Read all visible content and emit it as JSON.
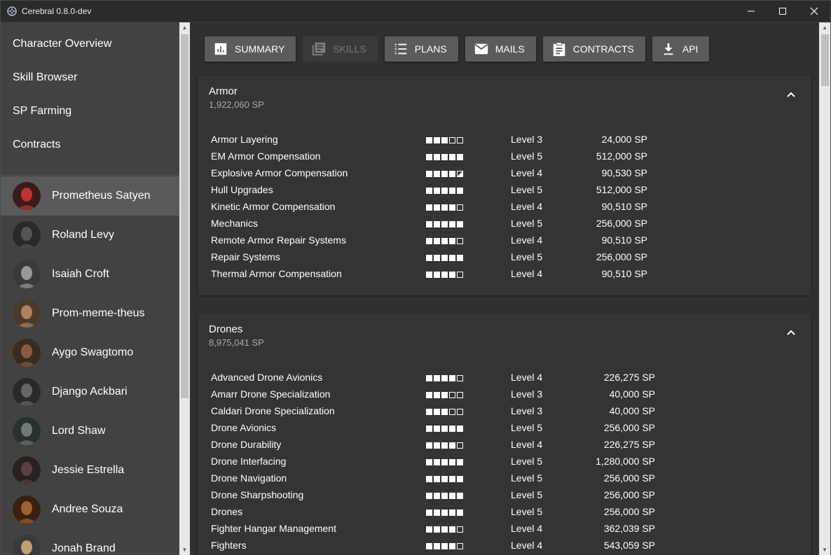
{
  "window": {
    "title": "Cerebral 0.8.0-dev"
  },
  "nav": [
    {
      "label": "Character Overview"
    },
    {
      "label": "Skill Browser"
    },
    {
      "label": "SP Farming"
    },
    {
      "label": "Contracts"
    }
  ],
  "characters": [
    {
      "name": "Prometheus Satyen",
      "active": true
    },
    {
      "name": "Roland Levy"
    },
    {
      "name": "Isaiah Croft"
    },
    {
      "name": "Prom-meme-theus"
    },
    {
      "name": "Aygo Swagtomo"
    },
    {
      "name": "Django Ackbari"
    },
    {
      "name": "Lord Shaw"
    },
    {
      "name": "Jessie Estrella"
    },
    {
      "name": "Andree Souza"
    },
    {
      "name": "Jonah Brand"
    }
  ],
  "toolbar": {
    "summary": "SUMMARY",
    "skills": "SKILLS",
    "plans": "PLANS",
    "mails": "MAILS",
    "contracts": "CONTRACTS",
    "api": "API"
  },
  "groups": [
    {
      "name": "Armor",
      "sp": "1,922,060 SP",
      "skills": [
        {
          "name": "Armor Layering",
          "boxes": [
            1,
            1,
            1,
            0,
            0
          ],
          "level": "Level 3",
          "sp": "24,000 SP"
        },
        {
          "name": "EM Armor Compensation",
          "boxes": [
            1,
            1,
            1,
            1,
            1
          ],
          "level": "Level 5",
          "sp": "512,000 SP"
        },
        {
          "name": "Explosive Armor Compensation",
          "boxes": [
            1,
            1,
            1,
            1,
            0.5
          ],
          "level": "Level 4",
          "sp": "90,530 SP"
        },
        {
          "name": "Hull Upgrades",
          "boxes": [
            1,
            1,
            1,
            1,
            1
          ],
          "level": "Level 5",
          "sp": "512,000 SP"
        },
        {
          "name": "Kinetic Armor Compensation",
          "boxes": [
            1,
            1,
            1,
            1,
            0
          ],
          "level": "Level 4",
          "sp": "90,510 SP"
        },
        {
          "name": "Mechanics",
          "boxes": [
            1,
            1,
            1,
            1,
            1
          ],
          "level": "Level 5",
          "sp": "256,000 SP"
        },
        {
          "name": "Remote Armor Repair Systems",
          "boxes": [
            1,
            1,
            1,
            1,
            0
          ],
          "level": "Level 4",
          "sp": "90,510 SP"
        },
        {
          "name": "Repair Systems",
          "boxes": [
            1,
            1,
            1,
            1,
            1
          ],
          "level": "Level 5",
          "sp": "256,000 SP"
        },
        {
          "name": "Thermal Armor Compensation",
          "boxes": [
            1,
            1,
            1,
            1,
            0
          ],
          "level": "Level 4",
          "sp": "90,510 SP"
        }
      ]
    },
    {
      "name": "Drones",
      "sp": "8,975,041 SP",
      "skills": [
        {
          "name": "Advanced Drone Avionics",
          "boxes": [
            1,
            1,
            1,
            1,
            0
          ],
          "level": "Level 4",
          "sp": "226,275 SP"
        },
        {
          "name": "Amarr Drone Specialization",
          "boxes": [
            1,
            1,
            1,
            0,
            0
          ],
          "level": "Level 3",
          "sp": "40,000 SP"
        },
        {
          "name": "Caldari Drone Specialization",
          "boxes": [
            1,
            1,
            1,
            0,
            0
          ],
          "level": "Level 3",
          "sp": "40,000 SP"
        },
        {
          "name": "Drone Avionics",
          "boxes": [
            1,
            1,
            1,
            1,
            1
          ],
          "level": "Level 5",
          "sp": "256,000 SP"
        },
        {
          "name": "Drone Durability",
          "boxes": [
            1,
            1,
            1,
            1,
            0
          ],
          "level": "Level 4",
          "sp": "226,275 SP"
        },
        {
          "name": "Drone Interfacing",
          "boxes": [
            1,
            1,
            1,
            1,
            1
          ],
          "level": "Level 5",
          "sp": "1,280,000 SP"
        },
        {
          "name": "Drone Navigation",
          "boxes": [
            1,
            1,
            1,
            1,
            1
          ],
          "level": "Level 5",
          "sp": "256,000 SP"
        },
        {
          "name": "Drone Sharpshooting",
          "boxes": [
            1,
            1,
            1,
            1,
            1
          ],
          "level": "Level 5",
          "sp": "256,000 SP"
        },
        {
          "name": "Drones",
          "boxes": [
            1,
            1,
            1,
            1,
            1
          ],
          "level": "Level 5",
          "sp": "256,000 SP"
        },
        {
          "name": "Fighter Hangar Management",
          "boxes": [
            1,
            1,
            1,
            1,
            0
          ],
          "level": "Level 4",
          "sp": "362,039 SP"
        },
        {
          "name": "Fighters",
          "boxes": [
            1,
            1,
            1,
            1,
            0
          ],
          "level": "Level 4",
          "sp": "543,059 SP"
        }
      ]
    }
  ],
  "colors": {
    "accent_bg": "#5b5b5b",
    "sidebar_bg": "#424242",
    "active_bg": "#5a5a5a"
  }
}
